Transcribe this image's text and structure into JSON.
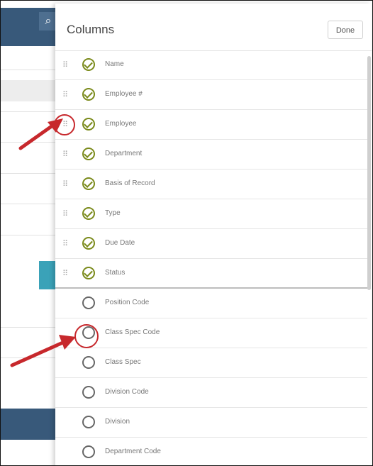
{
  "background": {
    "search_icon": "⌕"
  },
  "panel": {
    "title": "Columns",
    "done_label": "Done"
  },
  "columns": [
    {
      "label": "Name",
      "active": true
    },
    {
      "label": "Employee #",
      "active": true
    },
    {
      "label": "Employee",
      "active": true
    },
    {
      "label": "Department",
      "active": true
    },
    {
      "label": "Basis of Record",
      "active": true
    },
    {
      "label": "Type",
      "active": true
    },
    {
      "label": "Due Date",
      "active": true
    },
    {
      "label": "Status",
      "active": true
    },
    {
      "label": "Position Code",
      "active": false
    },
    {
      "label": "Class Spec Code",
      "active": false
    },
    {
      "label": "Class Spec",
      "active": false
    },
    {
      "label": "Division Code",
      "active": false
    },
    {
      "label": "Division",
      "active": false
    },
    {
      "label": "Department Code",
      "active": false
    }
  ],
  "colors": {
    "check": "#7a8a1a",
    "annotation": "#c7282c",
    "header_bg": "#38597a",
    "teal": "#3aa2b8"
  }
}
